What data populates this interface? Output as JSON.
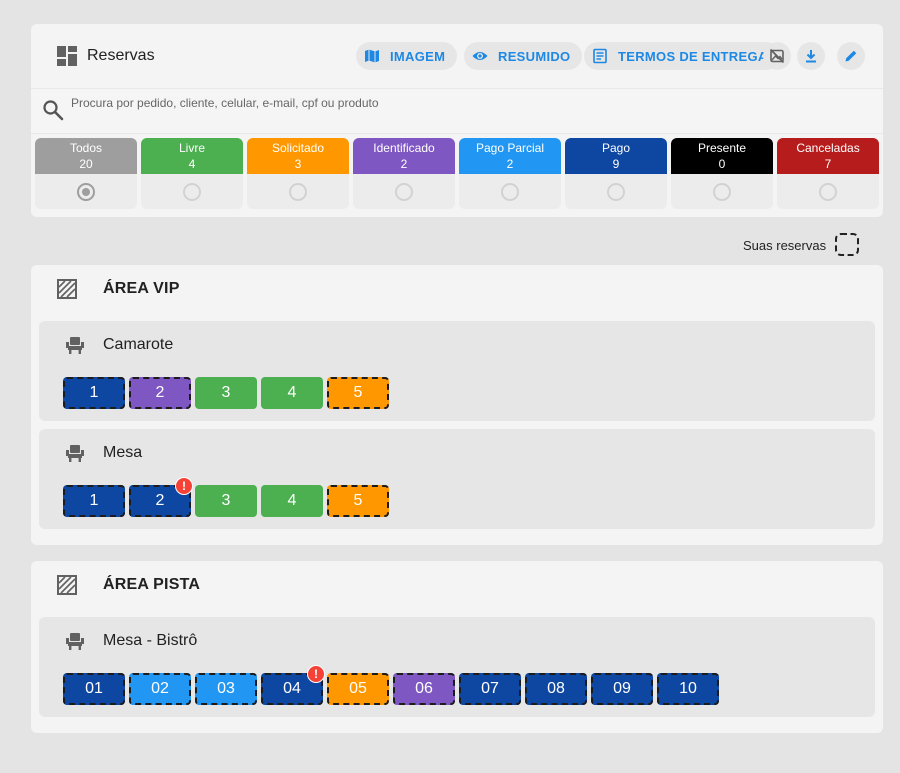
{
  "header": {
    "title": "Reservas",
    "btn_imagem": "IMAGEM",
    "btn_resumido": "RESUMIDO",
    "btn_termos": "TERMOS DE ENTREGA",
    "accent": "#1e88e5"
  },
  "search": {
    "placeholder": "Procura por pedido, cliente, celular, e-mail, cpf ou produto",
    "value": ""
  },
  "statuses": [
    {
      "label": "Todos",
      "count": "20",
      "color": "#9e9e9e",
      "selected": true
    },
    {
      "label": "Livre",
      "count": "4",
      "color": "#4caf50",
      "selected": false
    },
    {
      "label": "Solicitado",
      "count": "3",
      "color": "#ff9800",
      "selected": false
    },
    {
      "label": "Identificado",
      "count": "2",
      "color": "#7e57c2",
      "selected": false
    },
    {
      "label": "Pago Parcial",
      "count": "2",
      "color": "#2196f3",
      "selected": false
    },
    {
      "label": "Pago",
      "count": "9",
      "color": "#0d47a1",
      "selected": false
    },
    {
      "label": "Presente",
      "count": "0",
      "color": "#000000",
      "selected": false
    },
    {
      "label": "Canceladas",
      "count": "7",
      "color": "#b71c1c",
      "selected": false
    }
  ],
  "legend": {
    "label": "Suas reservas"
  },
  "areas": [
    {
      "title": "ÁREA VIP",
      "sectors": [
        {
          "name": "Camarote",
          "seats": [
            {
              "label": "1",
              "status": "Pago",
              "mine": true,
              "alert": false
            },
            {
              "label": "2",
              "status": "Identificado",
              "mine": true,
              "alert": false
            },
            {
              "label": "3",
              "status": "Livre",
              "mine": false,
              "alert": false
            },
            {
              "label": "4",
              "status": "Livre",
              "mine": false,
              "alert": false
            },
            {
              "label": "5",
              "status": "Solicitado",
              "mine": true,
              "alert": false
            }
          ]
        },
        {
          "name": "Mesa",
          "seats": [
            {
              "label": "1",
              "status": "Pago",
              "mine": true,
              "alert": false
            },
            {
              "label": "2",
              "status": "Pago",
              "mine": true,
              "alert": true
            },
            {
              "label": "3",
              "status": "Livre",
              "mine": false,
              "alert": false
            },
            {
              "label": "4",
              "status": "Livre",
              "mine": false,
              "alert": false
            },
            {
              "label": "5",
              "status": "Solicitado",
              "mine": true,
              "alert": false
            }
          ]
        }
      ]
    },
    {
      "title": "ÁREA PISTA",
      "sectors": [
        {
          "name": "Mesa - Bistrô",
          "seats": [
            {
              "label": "01",
              "status": "Pago",
              "mine": true,
              "alert": false
            },
            {
              "label": "02",
              "status": "Pago Parcial",
              "mine": true,
              "alert": false
            },
            {
              "label": "03",
              "status": "Pago Parcial",
              "mine": true,
              "alert": false
            },
            {
              "label": "04",
              "status": "Pago",
              "mine": true,
              "alert": true
            },
            {
              "label": "05",
              "status": "Solicitado",
              "mine": true,
              "alert": false
            },
            {
              "label": "06",
              "status": "Identificado",
              "mine": true,
              "alert": false
            },
            {
              "label": "07",
              "status": "Pago",
              "mine": true,
              "alert": false
            },
            {
              "label": "08",
              "status": "Pago",
              "mine": true,
              "alert": false
            },
            {
              "label": "09",
              "status": "Pago",
              "mine": true,
              "alert": false
            },
            {
              "label": "10",
              "status": "Pago",
              "mine": true,
              "alert": false
            }
          ]
        }
      ]
    }
  ],
  "alert_glyph": "!"
}
